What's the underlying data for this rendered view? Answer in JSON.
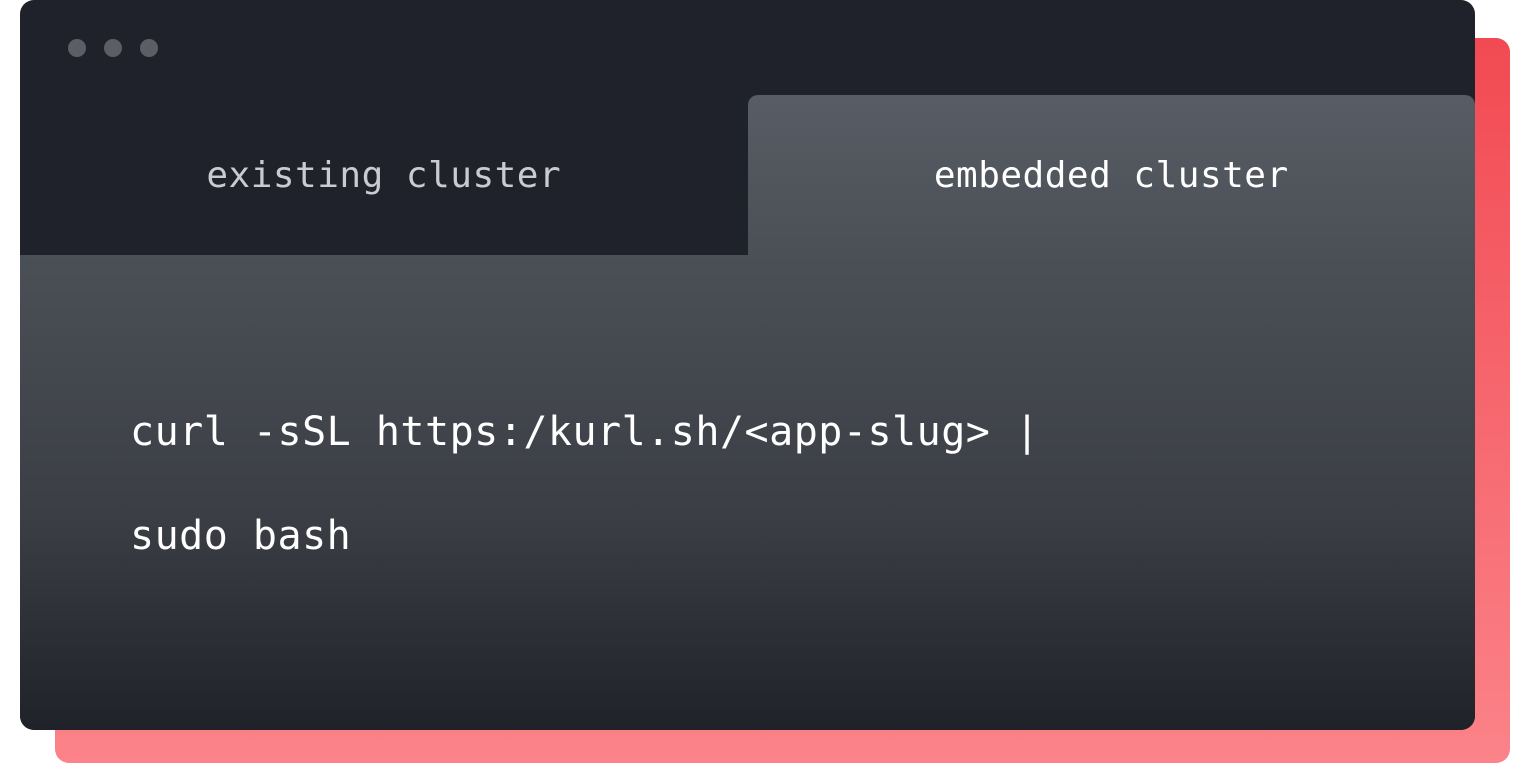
{
  "tabs": {
    "inactive_label": "existing cluster",
    "active_label": "embedded cluster"
  },
  "code": {
    "line1": "curl -sSL https:/kurl.sh/<app-slug> |",
    "line2": "sudo bash"
  },
  "colors": {
    "accent": "#f24a53",
    "window_bg": "#1f222a",
    "tab_active_bg": "#55595f",
    "text": "#ffffff"
  }
}
